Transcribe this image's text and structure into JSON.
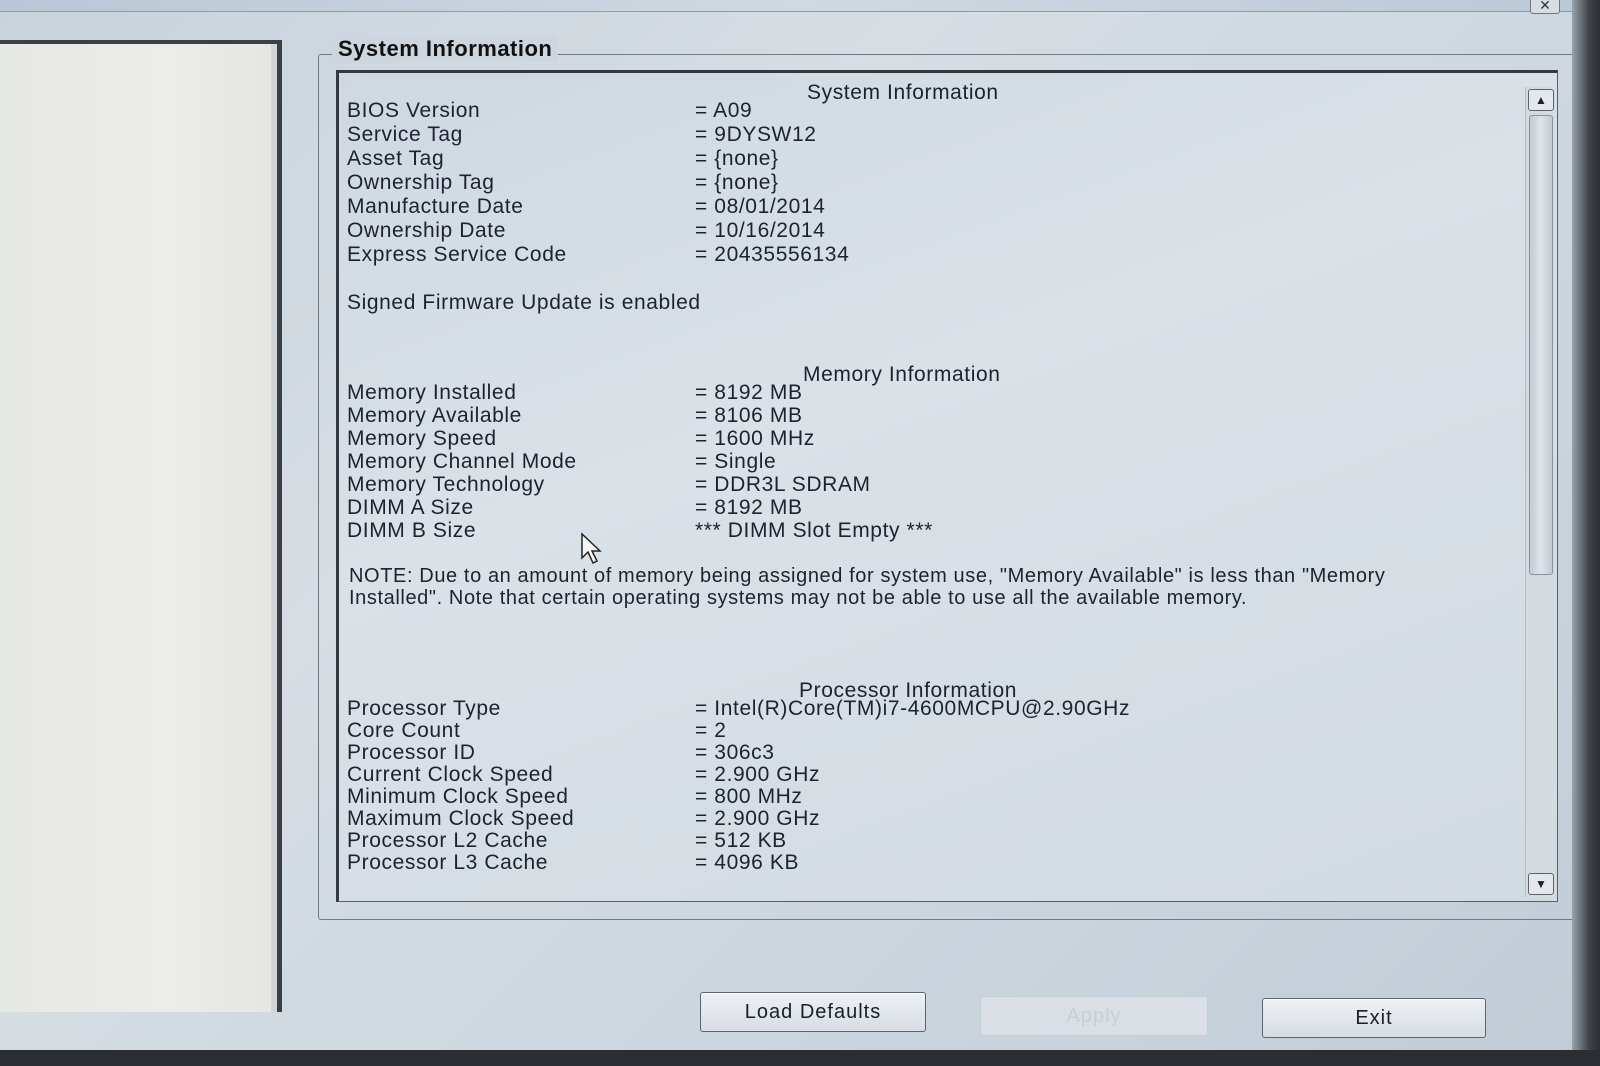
{
  "window": {
    "close_label": "✕"
  },
  "group_title": "System Information",
  "system": {
    "heading": "System Information",
    "rows": [
      {
        "key": "BIOS Version",
        "value": "= A09"
      },
      {
        "key": "Service Tag",
        "value": "= 9DYSW12"
      },
      {
        "key": "Asset Tag",
        "value": "= {none}"
      },
      {
        "key": "Ownership Tag",
        "value": "= {none}"
      },
      {
        "key": "Manufacture Date",
        "value": "= 08/01/2014"
      },
      {
        "key": "Ownership Date",
        "value": "= 10/16/2014"
      },
      {
        "key": "Express Service Code",
        "value": "= 20435556134"
      }
    ],
    "firmware_note": "Signed Firmware Update is enabled"
  },
  "memory": {
    "heading": "Memory Information",
    "rows": [
      {
        "key": "Memory Installed",
        "value": "= 8192 MB"
      },
      {
        "key": "Memory Available",
        "value": "= 8106 MB"
      },
      {
        "key": "Memory Speed",
        "value": "= 1600 MHz"
      },
      {
        "key": "Memory Channel Mode",
        "value": "= Single"
      },
      {
        "key": "Memory Technology",
        "value": "= DDR3L SDRAM"
      },
      {
        "key": "DIMM A Size",
        "value": "= 8192 MB"
      },
      {
        "key": "DIMM B Size",
        "value": "*** DIMM Slot Empty ***"
      }
    ],
    "note": "NOTE: Due to an amount of memory being assigned for system use, \"Memory Available\" is less than \"Memory Installed\". Note that certain operating systems may not be able to use all the available memory."
  },
  "processor": {
    "heading": "Processor Information",
    "rows": [
      {
        "key": "Processor Type",
        "value": "= Intel(R)Core(TM)i7-4600MCPU@2.90GHz"
      },
      {
        "key": "Core Count",
        "value": "= 2"
      },
      {
        "key": "Processor ID",
        "value": "= 306c3"
      },
      {
        "key": "Current Clock Speed",
        "value": "= 2.900 GHz"
      },
      {
        "key": "Minimum Clock Speed",
        "value": "= 800 MHz"
      },
      {
        "key": "Maximum Clock Speed",
        "value": "= 2.900 GHz"
      },
      {
        "key": "Processor L2 Cache",
        "value": "= 512 KB"
      },
      {
        "key": "Processor L3 Cache",
        "value": "= 4096 KB"
      }
    ]
  },
  "scrollbar": {
    "up_icon": "▲",
    "down_icon": "▼"
  },
  "buttons": {
    "load_defaults": "Load Defaults",
    "apply": "Apply",
    "exit": "Exit"
  }
}
